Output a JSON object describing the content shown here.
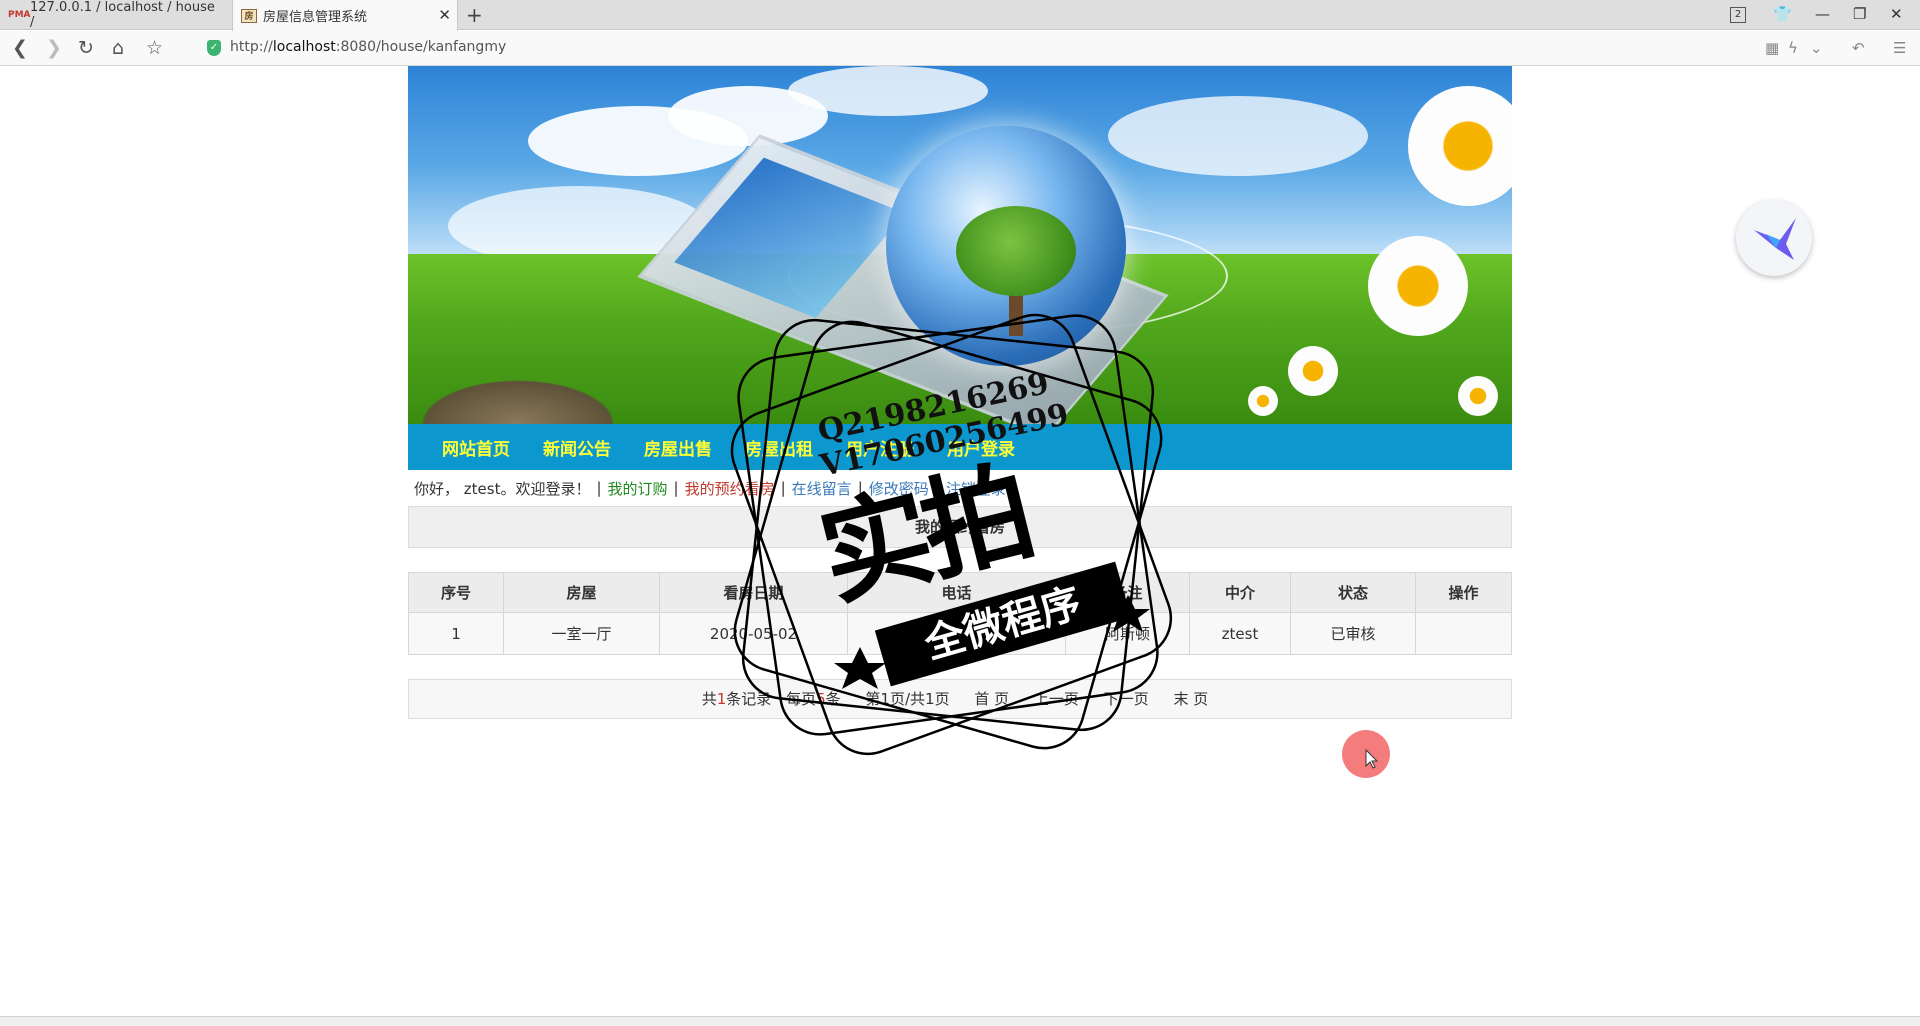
{
  "browser": {
    "tabs": [
      {
        "label": "127.0.0.1 / localhost / house /",
        "favicon": "PMA"
      },
      {
        "label": "房屋信息管理系统",
        "favicon": "房"
      }
    ],
    "window_badge": "2",
    "url_prefix": "http://",
    "url_host": "localhost",
    "url_rest": ":8080/house/kanfangmy"
  },
  "menu": [
    "网站首页",
    "新闻公告",
    "房屋出售",
    "房屋出租",
    "用户注册",
    "用户登录"
  ],
  "welcome": {
    "greeting": "你好， ztest。欢迎登录！",
    "links": [
      {
        "label": "我的订购",
        "color": "#1f8a1f"
      },
      {
        "label": "我的预约看房",
        "color": "#c0392b"
      },
      {
        "label": "在线留言",
        "color": "#3a7ab8"
      },
      {
        "label": "修改密码",
        "color": "#3a7ab8"
      },
      {
        "label": "注销登录",
        "color": "#3a7ab8"
      }
    ]
  },
  "section_title": "我的预约看房",
  "table": {
    "headers": [
      "序号",
      "房屋",
      "看房日期",
      "电话",
      "备注",
      "中介",
      "状态",
      "操作"
    ],
    "rows": [
      [
        "1",
        "一室一厅",
        "2020-05-02",
        "18300000000",
        "阿斯顿",
        "ztest",
        "已审核",
        ""
      ]
    ]
  },
  "pager": {
    "total_prefix": "共",
    "total": "1",
    "total_suffix": "条记录",
    "per_prefix": "每页",
    "per": "5",
    "per_suffix": "条",
    "page_text": "第1页/共1页",
    "first": "首 页",
    "prev": "上一页",
    "next": "下一页",
    "last": "末 页"
  },
  "watermark": {
    "line1": "Q2198216269",
    "line2": "V17060256499",
    "big": "实拍",
    "band": "全微程序"
  }
}
